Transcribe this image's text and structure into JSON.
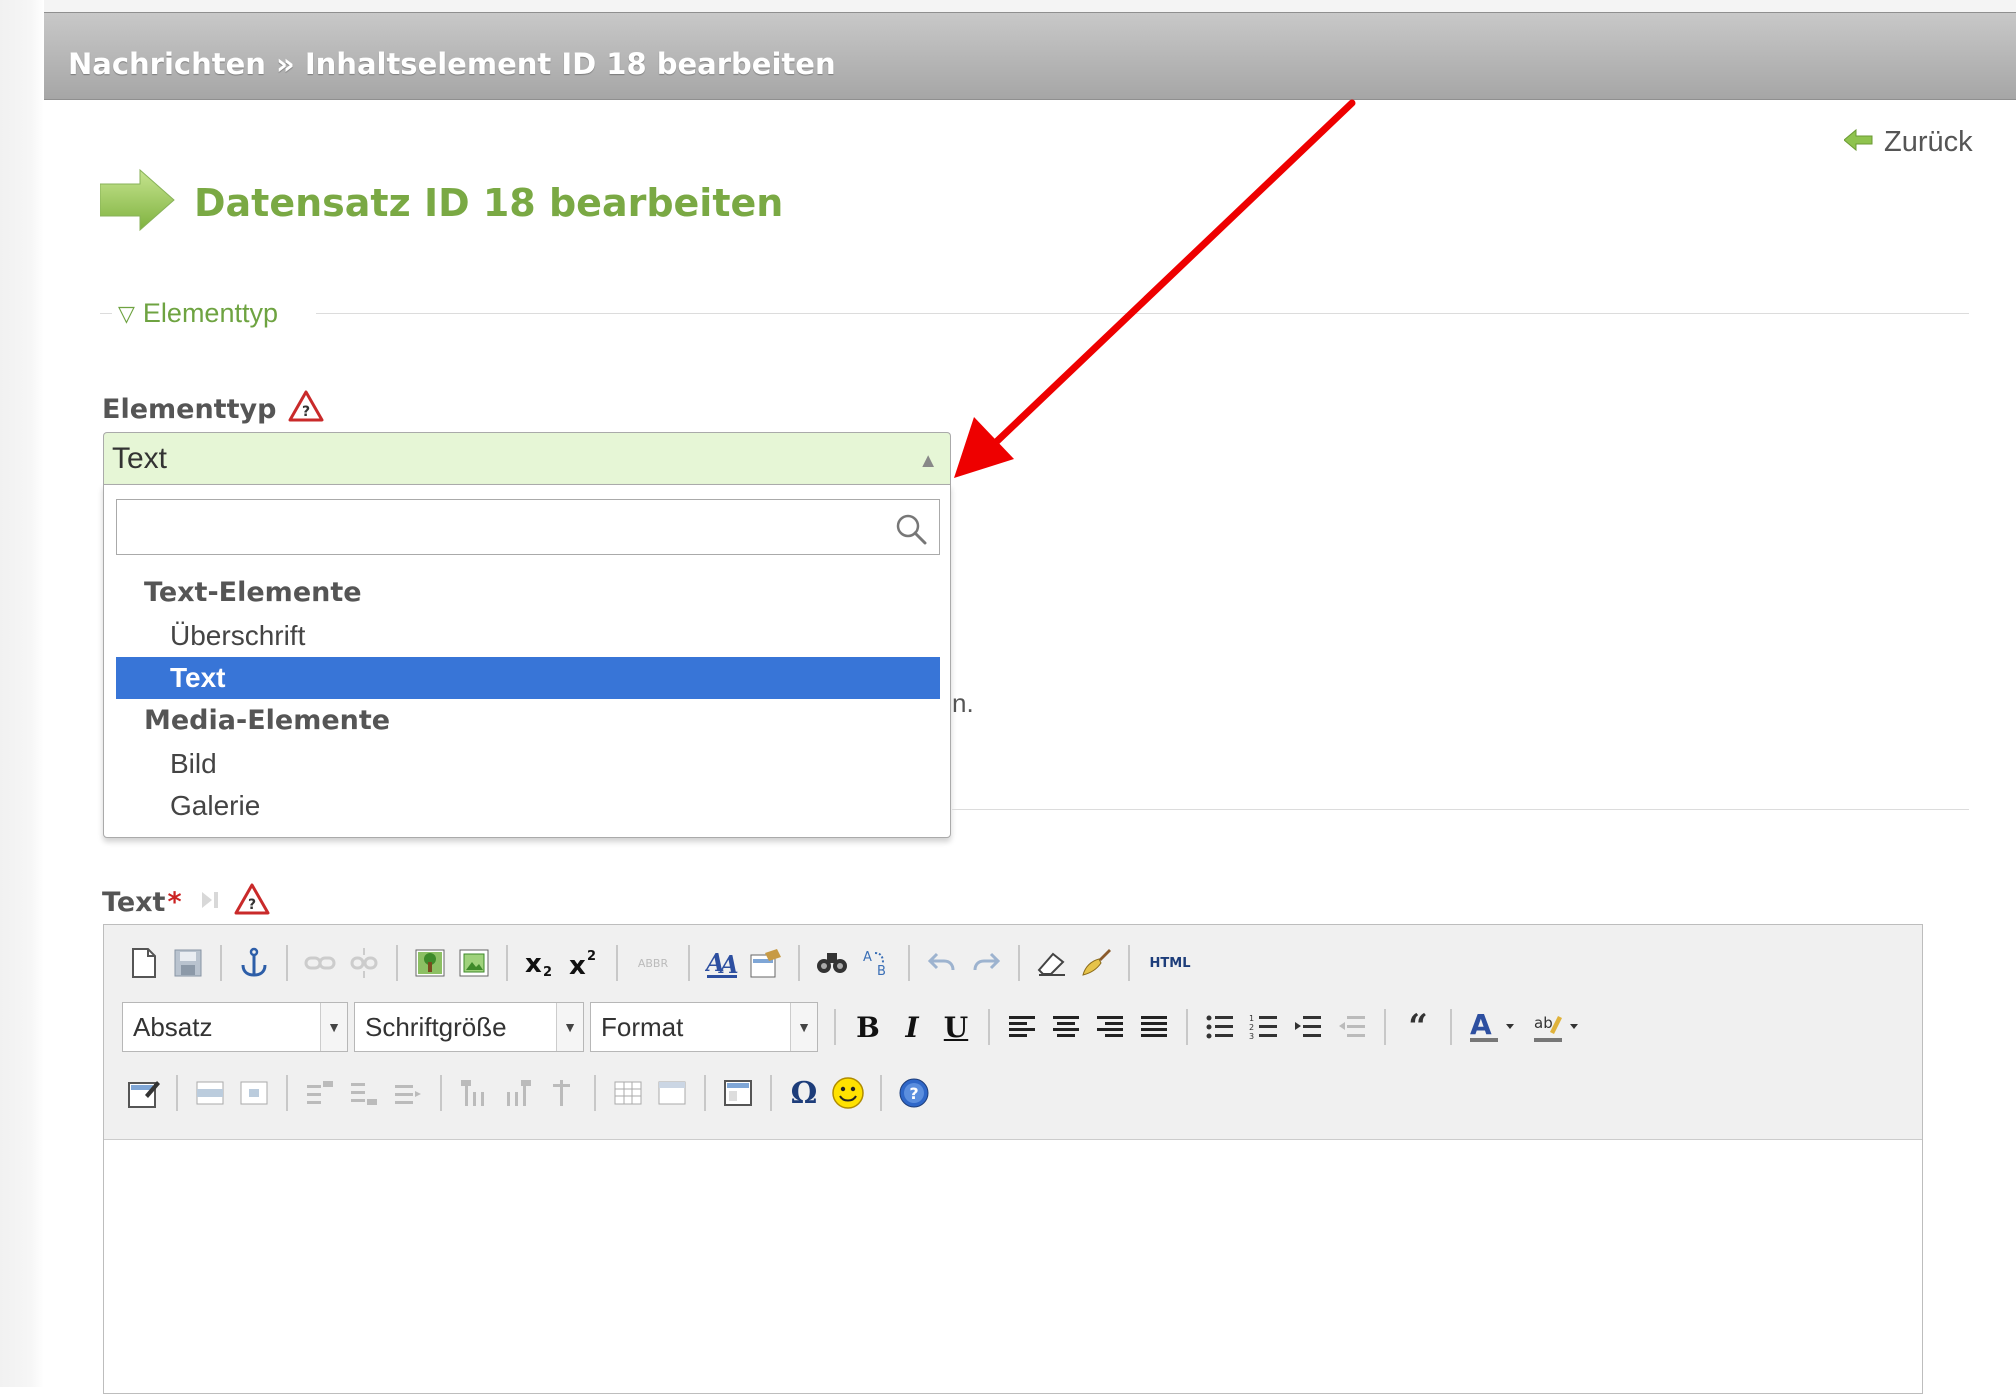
{
  "window": {
    "title": "Nachrichten » Inhaltselement ID 18 bearbeiten"
  },
  "back_link": {
    "label": "Zurück",
    "icon": "back-arrow-icon"
  },
  "heading": {
    "title": "Datensatz ID 18 bearbeiten",
    "icon": "green-arrow-icon"
  },
  "fieldset": {
    "legend": "Elementtyp",
    "toggle_icon": "triangle-down-icon"
  },
  "element_type": {
    "label": "Elementtyp",
    "help_icon": "warning-help-icon",
    "selected": "Text",
    "search_value": "",
    "groups": [
      {
        "label": "Text-Elemente",
        "options": [
          "Überschrift",
          "Text"
        ]
      },
      {
        "label": "Media-Elemente",
        "options": [
          "Bild",
          "Galerie"
        ]
      }
    ],
    "highlighted": "Text"
  },
  "occluded_text_tail": "n.",
  "text_field": {
    "label": "Text",
    "required_marker": "*"
  },
  "editor": {
    "combos": {
      "paragraph": "Absatz",
      "font_size": "Schriftgröße",
      "format": "Format"
    },
    "buttons": {
      "bold": "B",
      "italic": "I",
      "underline": "U",
      "html": "HTML",
      "abbr": "ABBR",
      "omega": "Ω",
      "quote": "“"
    },
    "colors": {
      "accent": "#7aa944",
      "selection": "#3875d7",
      "select_bg": "#e6f6d6",
      "annotation_arrow": "#ee0000"
    }
  }
}
